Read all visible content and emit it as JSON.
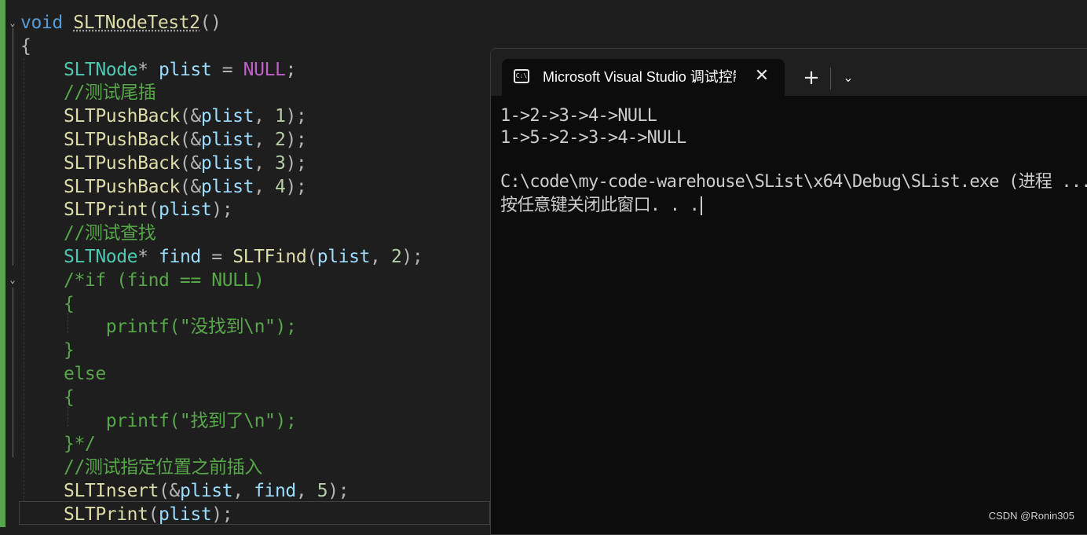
{
  "editor": {
    "lines": [
      [
        [
          "kw",
          "void"
        ],
        [
          "",
          ""
        ],
        [
          "fn underline",
          "SLTNodeTest2"
        ],
        [
          "op",
          "()"
        ]
      ],
      [
        [
          "op",
          "{"
        ]
      ],
      [
        [
          "",
          ""
        ],
        [
          "ty",
          "SLTNode"
        ],
        [
          "op",
          "* "
        ],
        [
          "var",
          "plist"
        ],
        [
          "op",
          " = "
        ],
        [
          "mac",
          "NULL"
        ],
        [
          "op",
          ";"
        ]
      ],
      [
        [
          "",
          ""
        ],
        [
          "cm",
          "//测试尾插"
        ]
      ],
      [
        [
          "",
          ""
        ],
        [
          "fn",
          "SLTPushBack"
        ],
        [
          "op",
          "(&"
        ],
        [
          "var",
          "plist"
        ],
        [
          "op",
          ", "
        ],
        [
          "num",
          "1"
        ],
        [
          "op",
          ");"
        ]
      ],
      [
        [
          "",
          ""
        ],
        [
          "fn",
          "SLTPushBack"
        ],
        [
          "op",
          "(&"
        ],
        [
          "var",
          "plist"
        ],
        [
          "op",
          ", "
        ],
        [
          "num",
          "2"
        ],
        [
          "op",
          ");"
        ]
      ],
      [
        [
          "",
          ""
        ],
        [
          "fn",
          "SLTPushBack"
        ],
        [
          "op",
          "(&"
        ],
        [
          "var",
          "plist"
        ],
        [
          "op",
          ", "
        ],
        [
          "num",
          "3"
        ],
        [
          "op",
          ");"
        ]
      ],
      [
        [
          "",
          ""
        ],
        [
          "fn",
          "SLTPushBack"
        ],
        [
          "op",
          "(&"
        ],
        [
          "var",
          "plist"
        ],
        [
          "op",
          ", "
        ],
        [
          "num",
          "4"
        ],
        [
          "op",
          ");"
        ]
      ],
      [
        [
          "",
          ""
        ],
        [
          "fn",
          "SLTPrint"
        ],
        [
          "op",
          "("
        ],
        [
          "var",
          "plist"
        ],
        [
          "op",
          ");"
        ]
      ],
      [
        [
          "",
          ""
        ],
        [
          "cm",
          "//测试查找"
        ]
      ],
      [
        [
          "",
          ""
        ],
        [
          "ty",
          "SLTNode"
        ],
        [
          "op",
          "* "
        ],
        [
          "var",
          "find"
        ],
        [
          "op",
          " = "
        ],
        [
          "fn",
          "SLTFind"
        ],
        [
          "op",
          "("
        ],
        [
          "var",
          "plist"
        ],
        [
          "op",
          ", "
        ],
        [
          "num",
          "2"
        ],
        [
          "op",
          ");"
        ]
      ],
      [
        [
          "",
          ""
        ],
        [
          "cm",
          "/*if (find == NULL)"
        ]
      ],
      [
        [
          "",
          ""
        ],
        [
          "cm",
          "{"
        ]
      ],
      [
        [
          "",
          ""
        ],
        [
          "cm",
          "    printf(\"没找到\\n\");"
        ]
      ],
      [
        [
          "",
          ""
        ],
        [
          "cm",
          "}"
        ]
      ],
      [
        [
          "",
          ""
        ],
        [
          "cm",
          "else"
        ]
      ],
      [
        [
          "",
          ""
        ],
        [
          "cm",
          "{"
        ]
      ],
      [
        [
          "",
          ""
        ],
        [
          "cm",
          "    printf(\"找到了\\n\");"
        ]
      ],
      [
        [
          "",
          ""
        ],
        [
          "cm",
          "}*/"
        ]
      ],
      [
        [
          "",
          ""
        ],
        [
          "cm",
          "//测试指定位置之前插入"
        ]
      ],
      [
        [
          "",
          ""
        ],
        [
          "fn",
          "SLTInsert"
        ],
        [
          "op",
          "(&"
        ],
        [
          "var",
          "plist"
        ],
        [
          "op",
          ", "
        ],
        [
          "var",
          "find"
        ],
        [
          "op",
          ", "
        ],
        [
          "num",
          "5"
        ],
        [
          "op",
          ");"
        ]
      ],
      [
        [
          "",
          ""
        ],
        [
          "fn",
          "SLTPrint"
        ],
        [
          "op",
          "("
        ],
        [
          "var",
          "plist"
        ],
        [
          "op",
          ");"
        ]
      ]
    ],
    "fold_glyph": "⌄"
  },
  "terminal": {
    "tab_title": "Microsoft Visual Studio 调试控制台",
    "icon_text": "C:\\",
    "close_glyph": "✕",
    "new_tab_glyph": "+",
    "dropdown_glyph": "⌄",
    "output": [
      "1->2->3->4->NULL",
      "1->5->2->3->4->NULL",
      "",
      "C:\\code\\my-code-warehouse\\SList\\x64\\Debug\\SList.exe (进程 ...",
      "按任意键关闭此窗口. . ."
    ]
  },
  "watermark": "CSDN @Ronin305",
  "colors": {
    "editor_bg": "#1e1e1e",
    "terminal_bg": "#0c0c0c",
    "keyword": "#569cd6",
    "type": "#4ec9b0",
    "function": "#dcdcaa",
    "variable": "#9cdcfe",
    "number": "#b5cea8",
    "comment": "#57a64a",
    "macro": "#bd63c5"
  }
}
